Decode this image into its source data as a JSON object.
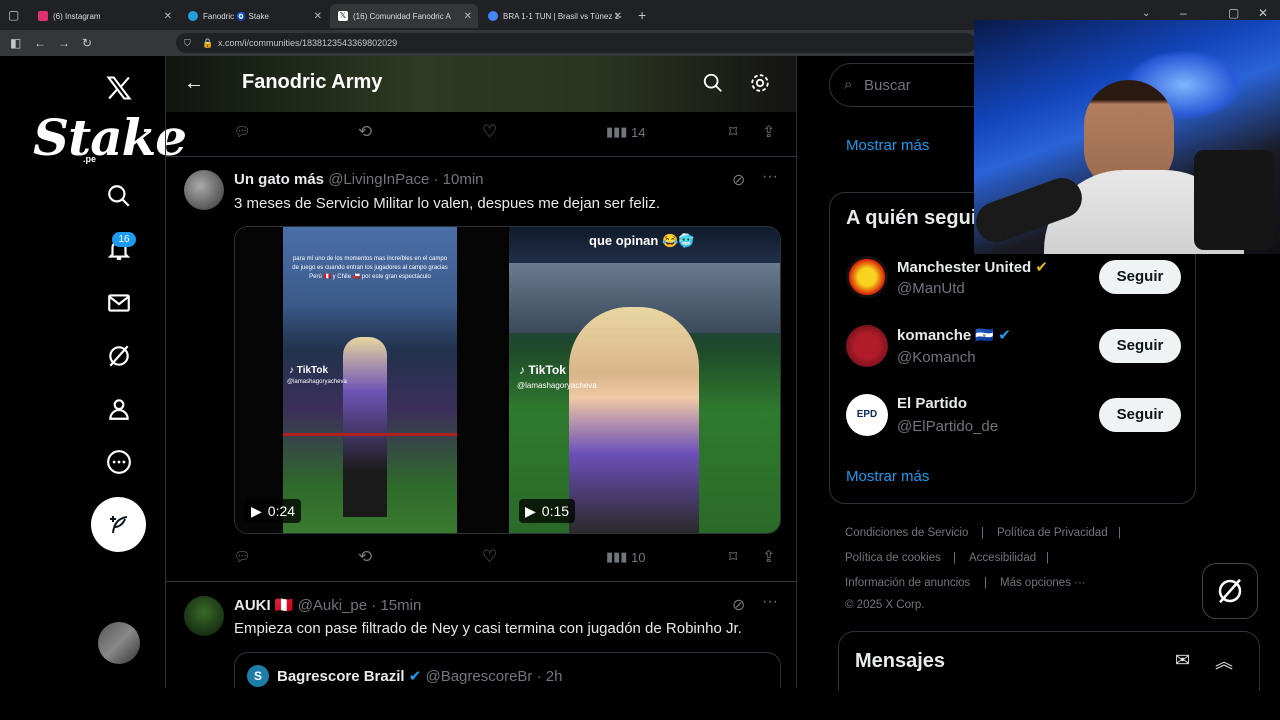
{
  "browser": {
    "tabs": [
      {
        "label": "(6) Instagram",
        "color": "#e1306c"
      },
      {
        "label": "Fanodric 🧿 Stake",
        "color": "#229ed9"
      },
      {
        "label": "(16) Comunidad Fanodric A",
        "color": "#ffffff"
      },
      {
        "label": "BRA 1-1 TUN | Brasil vs Túnez 1-",
        "color": "#4285f4"
      }
    ],
    "url": "x.com/i/communities/1838123543369802029"
  },
  "nav": {
    "badge": "16",
    "logo": "Stake",
    "logo_sub": ".pe"
  },
  "header": {
    "title": "Fanodric Army"
  },
  "top_actions": {
    "views": "14"
  },
  "tweet1": {
    "author": "Un gato más",
    "handle": "@LivingInPace",
    "time": "10min",
    "text": "3 meses de Servicio Militar lo valen, despues me dejan ser feliz.",
    "video1": {
      "duration": "0:24",
      "overlay": "para mí uno de los momentos mas increíbles en el campo de juego es cuando entran los jugadores al campo gracias Perú 🇵🇪 y Chile 🇨🇱 por este gran espectáculo",
      "tiktok": "TikTok",
      "tiktok_handle": "@lamashagoryacheva"
    },
    "video2": {
      "duration": "0:15",
      "caption": "que opinan 😂🥶",
      "tiktok": "TikTok",
      "tiktok_handle": "@lamashagoryacheva"
    },
    "views": "10"
  },
  "tweet2": {
    "author": "AUKI 🇵🇪",
    "handle": "@Auki_pe",
    "time": "15min",
    "text": "Empieza con pase filtrado de Ney y casi termina con jugadón de Robinho Jr.",
    "quote": {
      "author": "Bagrescore Brazil",
      "handle": "@BagrescoreBr",
      "time": "2h"
    }
  },
  "sidebar": {
    "search_placeholder": "Buscar",
    "show_more": "Mostrar más",
    "who_to_follow_title": "A quién seguir",
    "follow_label": "Seguir",
    "accounts": [
      {
        "name": "Manchester United",
        "handle": "@ManUtd"
      },
      {
        "name": "komanche 🇸🇻",
        "handle": "@Komanch"
      },
      {
        "name": "El Partido",
        "handle": "@ElPartido_de",
        "avatar_text": "EPD"
      }
    ],
    "footer": [
      "Condiciones de Servicio",
      "Política de Privacidad",
      "Política de cookies",
      "Accesibilidad",
      "Información de anuncios",
      "Más opciones ···",
      "© 2025 X Corp."
    ]
  },
  "messages": {
    "title": "Mensajes"
  }
}
